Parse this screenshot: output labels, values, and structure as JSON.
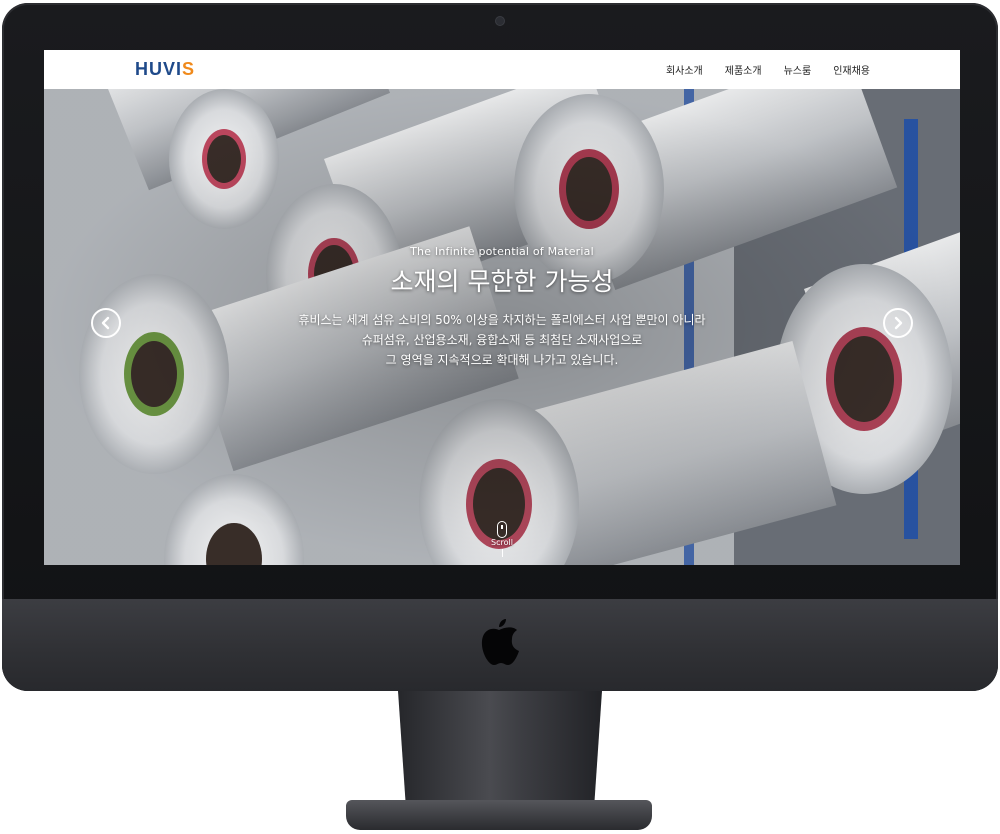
{
  "header": {
    "logo_text_main": "HUVI",
    "logo_text_accent": "S",
    "nav": [
      "회사소개",
      "제품소개",
      "뉴스룸",
      "인재채용"
    ]
  },
  "hero": {
    "subtitle": "The Infinite potential of Material",
    "title": "소재의 무한한 가능성",
    "description": [
      "휴비스는 세계 섬유 소비의 50% 이상을 차지하는 폴리에스터 사업 뿐만이 아니라",
      "슈퍼섬유, 산업용소재, 융합소재 등 최첨단 소재사업으로",
      "그 영역을 지속적으로 확대해 나가고 있습니다."
    ],
    "scroll_label": "Scroll"
  },
  "icons": {
    "prev": "chevron-left-icon",
    "next": "chevron-right-icon",
    "scroll": "mouse-icon",
    "device_logo": "apple-icon"
  },
  "colors": {
    "logo_blue": "#1f4a8a",
    "logo_orange": "#f08a1c"
  }
}
